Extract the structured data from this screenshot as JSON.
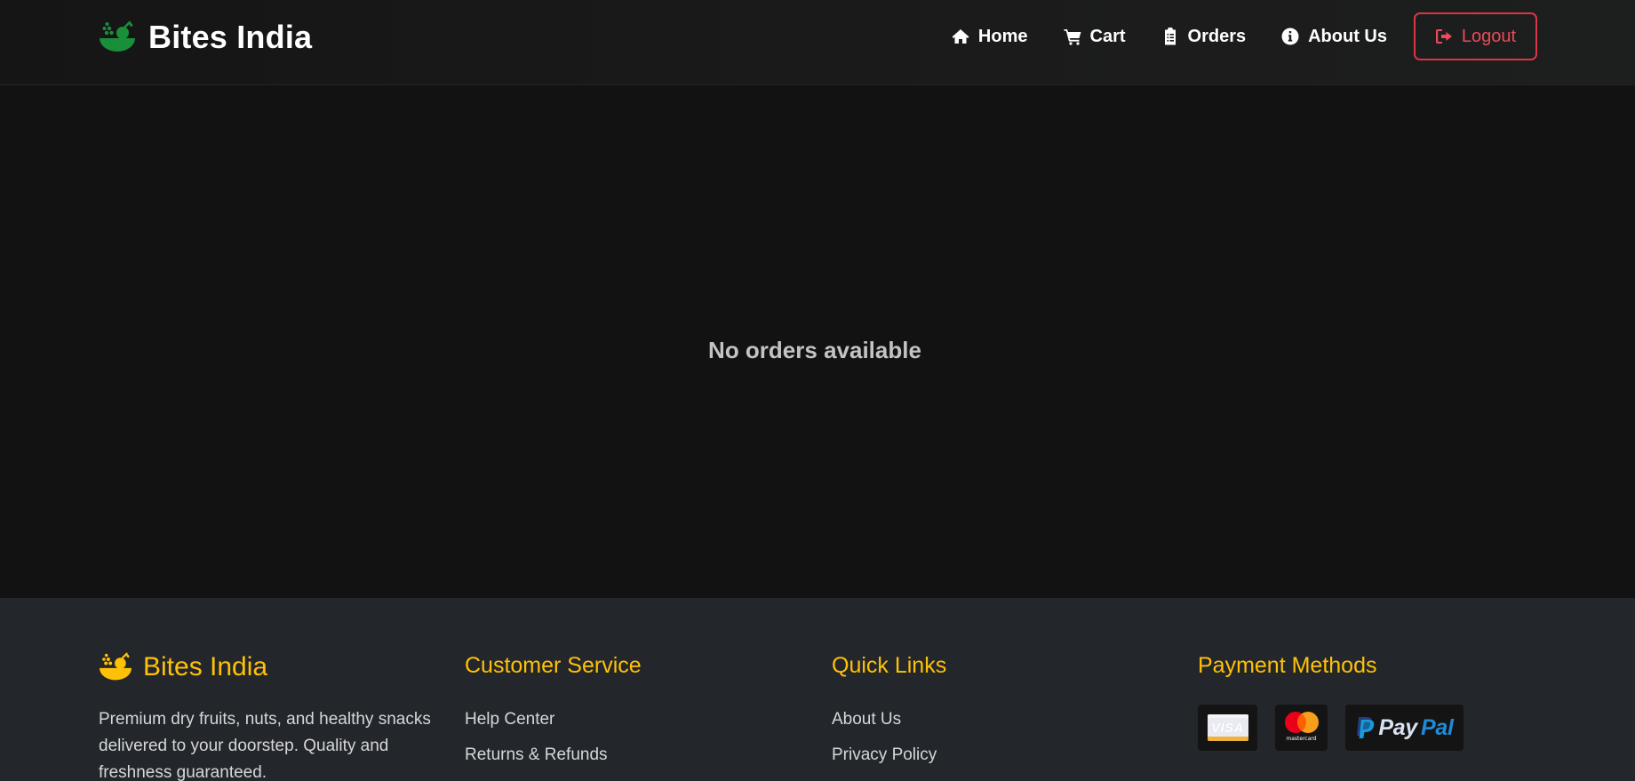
{
  "navbar": {
    "brand": "Bites India",
    "links": [
      {
        "label": "Home",
        "icon": "home-icon"
      },
      {
        "label": "Cart",
        "icon": "cart-icon"
      },
      {
        "label": "Orders",
        "icon": "clipboard-icon"
      },
      {
        "label": "About Us",
        "icon": "info-icon"
      }
    ],
    "logout_label": "Logout",
    "logout_icon": "sign-out-icon"
  },
  "main": {
    "empty_message": "No orders available"
  },
  "footer": {
    "brand": "Bites India",
    "description": "Premium dry fruits, nuts, and healthy snacks delivered to your doorstep. Quality and freshness guaranteed.",
    "customer_service": {
      "heading": "Customer Service",
      "links": [
        "Help Center",
        "Returns & Refunds"
      ]
    },
    "quick_links": {
      "heading": "Quick Links",
      "links": [
        "About Us",
        "Privacy Policy"
      ]
    },
    "payment": {
      "heading": "Payment Methods",
      "methods": [
        {
          "name": "visa-logo",
          "text": "VISA"
        },
        {
          "name": "mastercard-logo",
          "text": "mastercard"
        },
        {
          "name": "paypal-logo",
          "text_a": "Pay",
          "text_b": "Pal"
        }
      ]
    }
  },
  "colors": {
    "background": "#121212",
    "footer_bg": "#23262b",
    "brand_green": "#1a8f3a",
    "accent_yellow": "#ffc107",
    "danger_red": "#dc3545"
  }
}
